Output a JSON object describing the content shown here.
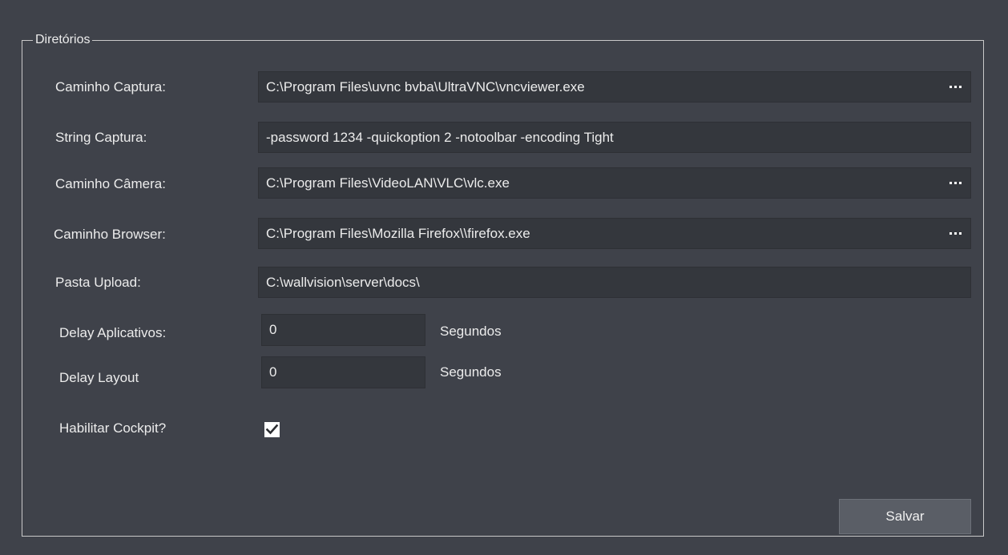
{
  "group": {
    "title": "Diretórios"
  },
  "fields": {
    "caminho_captura": {
      "label": "Caminho Captura:",
      "value": "C:\\Program Files\\uvnc bvba\\UltraVNC\\vncviewer.exe"
    },
    "string_captura": {
      "label": "String Captura:",
      "value": "-password 1234 -quickoption 2 -notoolbar -encoding Tight"
    },
    "caminho_camera": {
      "label": "Caminho Câmera:",
      "value": "C:\\Program Files\\VideoLAN\\VLC\\vlc.exe"
    },
    "caminho_browser": {
      "label": "Caminho Browser:",
      "value": "C:\\Program Files\\Mozilla Firefox\\\\firefox.exe"
    },
    "pasta_upload": {
      "label": "Pasta Upload:",
      "value": "C:\\wallvision\\server\\docs\\"
    },
    "delay_aplicativos": {
      "label": "Delay Aplicativos:",
      "value": "0",
      "unit": "Segundos"
    },
    "delay_layout": {
      "label": "Delay Layout",
      "value": "0",
      "unit": "Segundos"
    },
    "habilitar_cockpit": {
      "label": "Habilitar Cockpit?",
      "checked": true
    }
  },
  "actions": {
    "save_label": "Salvar"
  },
  "icons": {
    "browse": "more-horizontal-icon",
    "check": "checkmark-icon"
  },
  "colors": {
    "background": "#3f424a",
    "field_background": "#34373d",
    "button_background": "#5a5e66",
    "text": "#ececec"
  }
}
